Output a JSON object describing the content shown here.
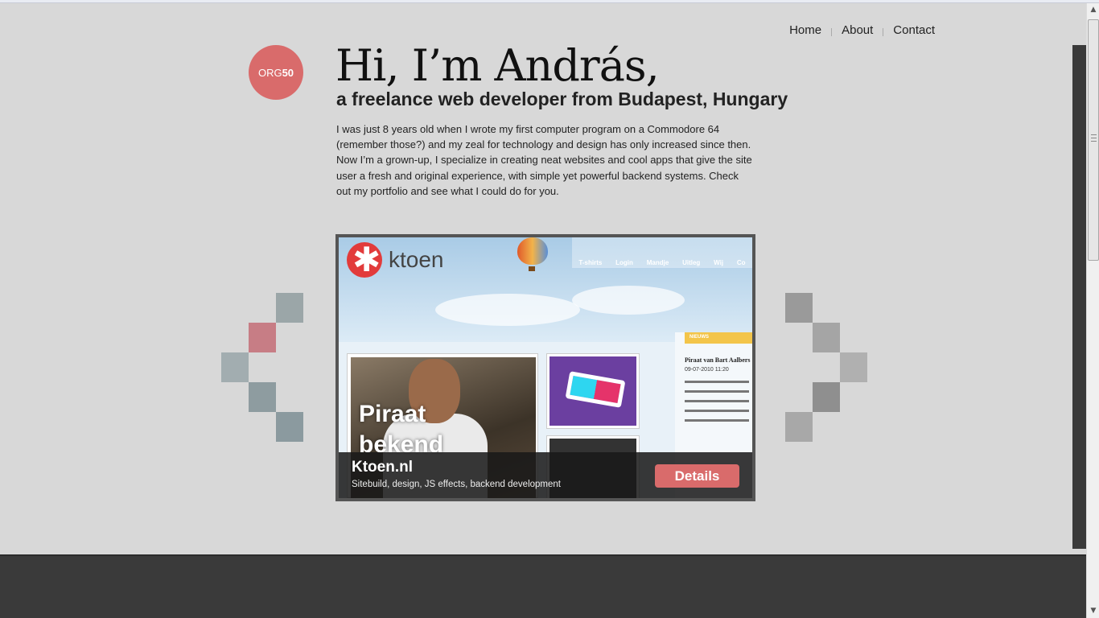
{
  "nav": {
    "items": [
      {
        "label": "Home"
      },
      {
        "label": "About"
      },
      {
        "label": "Contact"
      }
    ]
  },
  "logo": {
    "text_light": "ORG",
    "text_bold": "50",
    "color": "#d96b6b"
  },
  "hero": {
    "title": "Hi, I’m András,",
    "subtitle": "a freelance web developer from Budapest, Hungary",
    "intro": "I was just 8 years old when I wrote my first computer program on a Commodore 64 (remember those?) and my zeal for technology and design has only increased since then. Now I’m a grown-up, I specialize in creating neat websites and cool apps that give the site user a fresh and original experience, with simple yet powerful backend systems. Check out my portfolio and see what I could do for you."
  },
  "portfolio": {
    "current": {
      "title": "Ktoen.nl",
      "description": "Sitebuild, design, JS effects, backend development",
      "details_label": "Details"
    },
    "screenshot": {
      "brand": "ktoen",
      "nav": [
        "T-shirts",
        "Login",
        "Mandje",
        "Uitleg",
        "Wij",
        "Co"
      ],
      "hero_text_1": "Piraat",
      "hero_text_2": "bekend",
      "news_tab": "NIEUWS",
      "news_title": "Piraat van Bart Aalbers",
      "news_date": "09-07-2010 11:20"
    },
    "prev_arrow_icon": "pixel-arrow-left-icon",
    "next_arrow_icon": "pixel-arrow-right-icon"
  },
  "colors": {
    "accent": "#d96b6b",
    "background": "#d8d8d8",
    "footer": "#3a3a3a"
  }
}
